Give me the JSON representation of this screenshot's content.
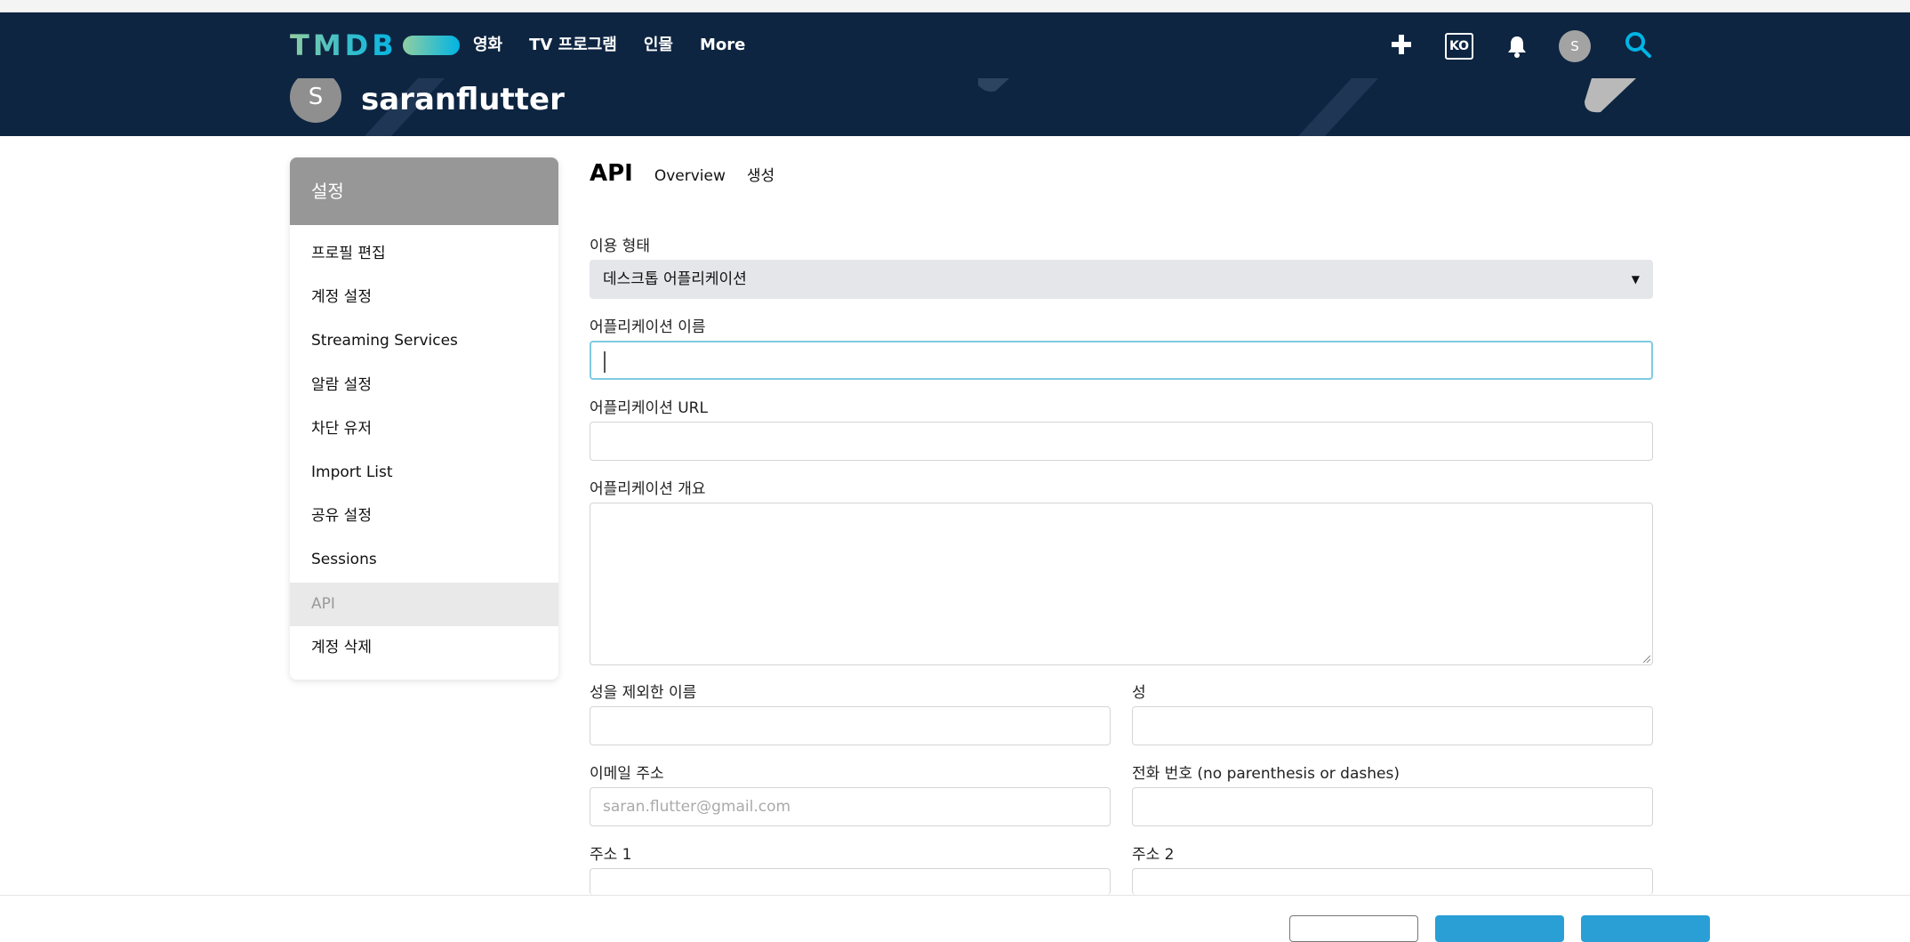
{
  "brand": {
    "name": "TMDB"
  },
  "nav": {
    "items": [
      "영화",
      "TV 프로그램",
      "인물",
      "More"
    ],
    "lang": "KO",
    "avatar_letter": "S"
  },
  "profile": {
    "avatar_letter": "S",
    "username": "saranflutter"
  },
  "sidebar": {
    "title": "설정",
    "items": [
      {
        "label": "프로필 편집"
      },
      {
        "label": "계정 설정"
      },
      {
        "label": "Streaming Services"
      },
      {
        "label": "알람 설정"
      },
      {
        "label": "차단 유저"
      },
      {
        "label": "Import List"
      },
      {
        "label": "공유 설정"
      },
      {
        "label": "Sessions"
      },
      {
        "label": "API",
        "active": true
      },
      {
        "label": "계정 삭제"
      }
    ]
  },
  "api": {
    "title": "API",
    "tabs": [
      "Overview",
      "생성"
    ]
  },
  "form": {
    "usage_label": "이용 형태",
    "usage_value": "데스크톱 어플리케이션",
    "app_name_label": "어플리케이션 이름",
    "app_name_value": "",
    "app_url_label": "어플리케이션 URL",
    "app_url_value": "",
    "app_summary_label": "어플리케이션 개요",
    "app_summary_value": "",
    "first_name_label": "성을 제외한 이름",
    "first_name_value": "",
    "last_name_label": "성",
    "last_name_value": "",
    "email_label": "이메일 주소",
    "email_placeholder": "saran.flutter@gmail.com",
    "phone_label": "전화 번호 (no parenthesis or dashes)",
    "phone_value": "",
    "address1_label": "주소 1",
    "address2_label": "주소 2"
  },
  "colors": {
    "navy": "#0d2541",
    "accent": "#01b4e4",
    "sidebar_head": "#979797"
  },
  "icons": {
    "plus": "plus-icon",
    "bell": "bell-icon",
    "search": "search-icon",
    "caret": "caret-down-icon"
  }
}
